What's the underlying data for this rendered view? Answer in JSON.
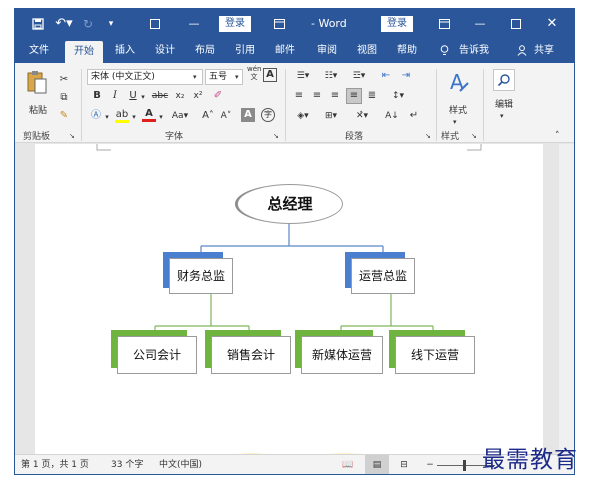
{
  "titlebar": {
    "login_left": "登录",
    "app_title": "- Word",
    "login_right": "登录"
  },
  "tabs": {
    "file": "文件",
    "home": "开始",
    "insert": "插入",
    "design": "设计",
    "layout": "布局",
    "references": "引用",
    "mailings": "邮件",
    "review": "审阅",
    "view": "视图",
    "help": "帮助",
    "tell_me": "告诉我",
    "share": "共享"
  },
  "ribbon": {
    "paste_label": "粘贴",
    "clipboard_group": "剪贴板",
    "font_name": "宋体 (中文正文)",
    "font_size": "五号",
    "wen_label": "wén\n文",
    "font_group": "字体",
    "paragraph_group": "段落",
    "styles_label": "样式",
    "styles_group": "样式",
    "editing_label": "编辑"
  },
  "org_chart": {
    "root": "总经理",
    "finance": "财务总监",
    "operations": "运营总监",
    "accountant": "公司会计",
    "sales_accountant": "销售会计",
    "new_media": "新媒体运营",
    "offline": "线下运营"
  },
  "statusbar": {
    "page_info": "第 1 页，共 1 页",
    "word_count": "33 个字",
    "language": "中文(中国)"
  },
  "watermark": "最需教育",
  "colors": {
    "accent": "#2b579a",
    "node_blue": "#4a7fd0",
    "node_green": "#6fb43f"
  }
}
